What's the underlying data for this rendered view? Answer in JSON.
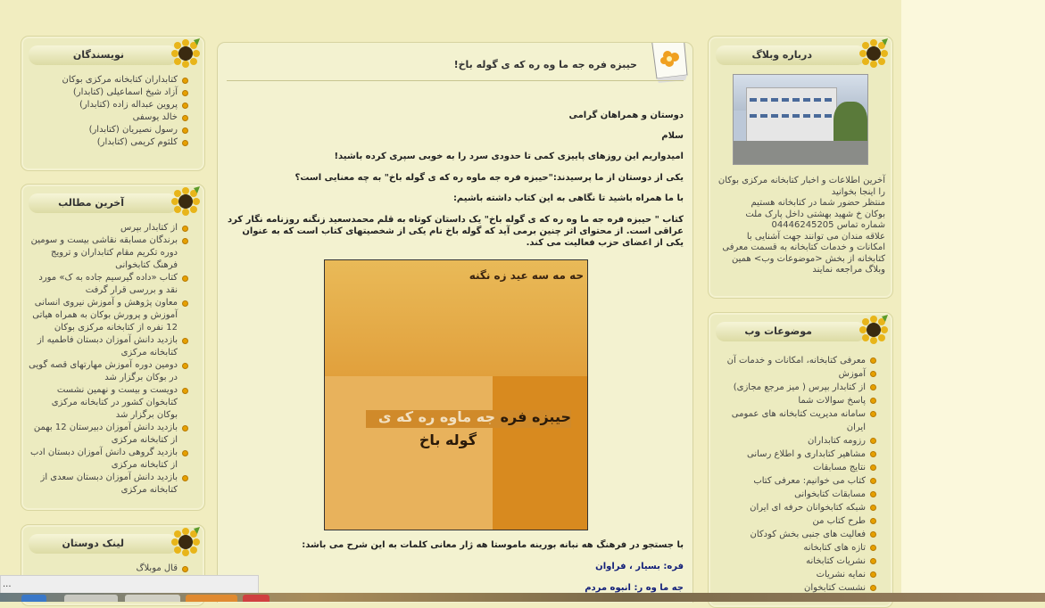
{
  "writers": {
    "title": "نویسندگان",
    "items": [
      "کتابداران کتابخانه مرکزی بوکان",
      "آزاد شیخ اسماعیلی (کتابدار)",
      "پروین عبداله زاده (کتابدار)",
      "خالد یوسفی",
      "رسول نصیریان (کتابدار)",
      "کلثوم کریمی (کتابدار)"
    ]
  },
  "latest": {
    "title": "آخرین مطالب",
    "items": [
      "از کتابدار بپرس",
      "برندگان مسابقه نقاشی بیست و سومین دوره تکریم مقام کتابداران و ترویج فرهنگ کتابخوانی",
      "کتاب «داده گیرسیم جاده به ک» مورد نقد و بررسی قرار گرفت",
      "معاون پژوهش و آموزش نیروی انسانی آموزش و پرورش بوکان به همراه هیاتی 12 نفره از کتابخانه مرکزی بوکان",
      "بازدید دانش آموزان دبستان فاطمیه از کتابخانه مرکزی",
      "دومین دوره آموزش مهارتهای قصه گویی در بوکان برگزار شد",
      "دویست و بیست و نهمین نشست کتابخوان کشور در کتابخانه مرکزی بوکان برگزار شد",
      "بازدید دانش آموزان دبیرستان 12 بهمن از کتابخانه مرکزی",
      "بازدید گروهی دانش آموزان دبستان ادب از کتابخانه مرکزی",
      "بازدید دانش آموزان دبستان سعدی از کتابخانه مرکزی"
    ]
  },
  "friends": {
    "title": "لینک دوستان",
    "items": [
      "قال موبلاگ"
    ]
  },
  "post": {
    "title": "حیبزه فره جه ما وه ره که ی گوله باخ!",
    "p1": "دوستان و همراهان گرامی",
    "p2": "سلام",
    "p3": "امیدواریم این روزهای پاییزی کمی تا حدودی سرد را به خوبی سپری کرده باشید!",
    "p4": "یکی از دوستان از ما پرسیدند:\"حیبزه فره جه ماوه ره که ی گوله باخ\" به چه معنایی است؟",
    "p5": "با ما همراه باشید تا نگاهی به این کتاب داشته باشیم:",
    "p6": "کتاب \" حیبزه فره جه ما وه ره که ی گوله باخ\" یک داستان کوتاه به قلم محمدسعید زنگنه روزنامه نگار کرد عراقی است. از محتوای اثر چنین برمی آید که گوله باخ نام یکی از شخصیتهای کتاب است که به عنوان یکی از اعضای حزب فعالیت می کند.",
    "book_author": "حه مه سه عید زه نگنه",
    "book_title1a": "حیبزه فره",
    "book_title1b": "جه ماوه ره که ی",
    "book_title2": "گوله باخ",
    "p7": "با جستجو در فرهنگ هه نبانه بورینه ماموستا هه ژار معانی کلمات به این شرح می باشد:",
    "d1": "فره: بسیار ، فراوان",
    "d2": "جه ما وه ر: انبوه مردم"
  },
  "about": {
    "title": "درباره وبلاگ",
    "text": [
      "آخرین اطلاعات و اخبار کتابخانه مرکزی بوکان را اینجا بخوانید",
      "منتظر حضور شما در کتابخانه هستیم",
      "بوکان خ شهید بهشتی داخل پارک ملت",
      "شماره تماس 04446245205",
      "علاقه مندان می توانند جهت آشنایی با امکانات و خدمات کتابخانه به قسمت معرفی کتابخانه از بخش <موضوعات وب> همین وبلاگ مراجعه نمایند"
    ]
  },
  "topics": {
    "title": "موضوعات وب",
    "items": [
      "معرفی کتابخانه، امکانات و خدمات آن",
      "آموزش",
      "از کتابدار بپرس ( میز مرجع مجازی)",
      "پاسخ سوالات شما",
      "سامانه مدیریت کتابخانه های عمومی ایران",
      "رزومه کتابداران",
      "مشاهیر کتابداری و اطلاع رسانی",
      "نتایج مسابقات",
      "کتاب می خوانیم: معرفی کتاب",
      "مسابقات کتابخوانی",
      "شبکه کتابخوانان حرفه ای ایران",
      "طرح کتاب من",
      "فعالیت های جنبی بخش کودکان",
      "تازه های کتابخانه",
      "نشریات کتابخانه",
      "نمایه نشریات",
      "نشست کتابخوان"
    ]
  },
  "status_bar": {
    "text": "..."
  }
}
